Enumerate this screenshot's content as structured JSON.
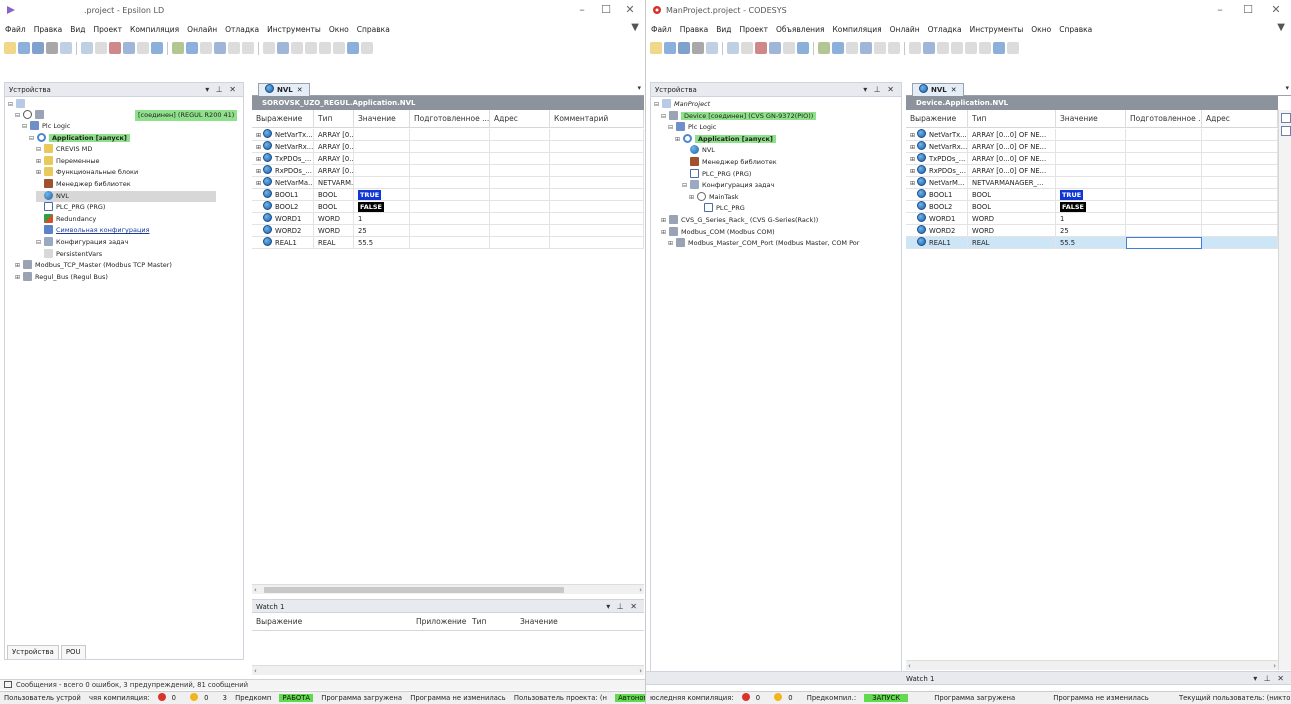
{
  "left": {
    "title": ".project - Epsilon LD",
    "menu": [
      "Файл",
      "Правка",
      "Вид",
      "Проект",
      "Компиляция",
      "Онлайн",
      "Отладка",
      "Инструменты",
      "Окно",
      "Справка"
    ],
    "devices_panel_title": "Устройства",
    "connected_label": "[соединен] (REGUL R200 41)",
    "tree": [
      {
        "label": "Plc Logic",
        "indent": 2,
        "icon": "plc-logic-icon",
        "style": ""
      },
      {
        "label": "Application [запуск]",
        "indent": 3,
        "icon": "application-icon",
        "style": "hl"
      },
      {
        "label": "CREVIS MD",
        "indent": 4,
        "icon": "folder-icon",
        "style": ""
      },
      {
        "label": "Переменные",
        "indent": 4,
        "icon": "folder-icon",
        "style": ""
      },
      {
        "label": "Функциональные блоки",
        "indent": 4,
        "icon": "folder-icon",
        "style": ""
      },
      {
        "label": "Менеджер библиотек",
        "indent": 4,
        "icon": "library-icon",
        "style": ""
      },
      {
        "label": "NVL",
        "indent": 4,
        "icon": "globe-icon",
        "style": "sel"
      },
      {
        "label": "PLC_PRG (PRG)",
        "indent": 4,
        "icon": "program-icon",
        "style": ""
      },
      {
        "label": "Redundancy",
        "indent": 4,
        "icon": "redundancy-icon",
        "style": ""
      },
      {
        "label": "Символьная конфигурация",
        "indent": 4,
        "icon": "symbol-config-icon",
        "style": "ul"
      },
      {
        "label": "Конфигурация задач",
        "indent": 4,
        "icon": "task-config-icon",
        "style": ""
      },
      {
        "label": "PersistentVars",
        "indent": 4,
        "icon": "persistent-icon",
        "style": ""
      },
      {
        "label": "Modbus_TCP_Master (Modbus TCP Master)",
        "indent": 1,
        "icon": "device-icon",
        "style": ""
      },
      {
        "label": "Regul_Bus (Regul Bus)",
        "indent": 1,
        "icon": "device-icon",
        "style": ""
      }
    ],
    "tab_label": "NVL",
    "doc_title": "SOROVSK_UZO_REGUL.Application.NVL",
    "columns": [
      "Выражение",
      "Тип",
      "Значение",
      "Подготовленное ...",
      "Адрес",
      "Комментарий"
    ],
    "rows": [
      {
        "expr": "NetVarTx...",
        "type": "ARRAY [0....",
        "value": "",
        "expand": true
      },
      {
        "expr": "NetVarRx...",
        "type": "ARRAY [0....",
        "value": "",
        "expand": true
      },
      {
        "expr": "TxPDOs_...",
        "type": "ARRAY [0....",
        "value": "",
        "expand": true
      },
      {
        "expr": "RxPDOs_...",
        "type": "ARRAY [0....",
        "value": "",
        "expand": true
      },
      {
        "expr": "NetVarMa...",
        "type": "NETVARM...",
        "value": "",
        "expand": true
      },
      {
        "expr": "BOOL1",
        "type": "BOOL",
        "value": "TRUE",
        "expand": false
      },
      {
        "expr": "BOOL2",
        "type": "BOOL",
        "value": "FALSE",
        "expand": false
      },
      {
        "expr": "WORD1",
        "type": "WORD",
        "value": "1",
        "expand": false
      },
      {
        "expr": "WORD2",
        "type": "WORD",
        "value": "25",
        "expand": false
      },
      {
        "expr": "REAL1",
        "type": "REAL",
        "value": "55.5",
        "expand": false
      }
    ],
    "watch_title": "Watch 1",
    "watch_columns": [
      "Выражение",
      "Приложение",
      "Тип",
      "Значение"
    ],
    "bottom_tabs": [
      "Устройства",
      "POU"
    ],
    "messages": "Сообщения - всего 0 ошибок, 3 предупреждений, 81 сообщений",
    "status": {
      "user_device": "Пользователь устрой",
      "last_compile": "чяя компиляция:",
      "errors": "0",
      "warnings": "0",
      "infos": "3",
      "precompile": "Предкомп",
      "run_state": "РАБОТА",
      "program_loaded": "Программа загружена",
      "program_unchanged": "Программа не изменилась",
      "project_user": "Пользователь проекта: (н",
      "offline": "Автономный"
    }
  },
  "right": {
    "title": "ManProject.project - CODESYS",
    "menu": [
      "Файл",
      "Правка",
      "Вид",
      "Проект",
      "Объявления",
      "Компиляция",
      "Онлайн",
      "Отладка",
      "Инструменты",
      "Окно",
      "Справка"
    ],
    "devices_panel_title": "Устройства",
    "tree": [
      {
        "label": "ManProject",
        "indent": 0,
        "icon": "project-icon",
        "style": "it"
      },
      {
        "label": "Device [соединен] (CVS GN-9372(PIO))",
        "indent": 1,
        "icon": "device-icon",
        "style": "hl"
      },
      {
        "label": "Plc Logic",
        "indent": 2,
        "icon": "plc-logic-icon",
        "style": ""
      },
      {
        "label": "Application [запуск]",
        "indent": 3,
        "icon": "application-icon",
        "style": "hl bold"
      },
      {
        "label": "NVL",
        "indent": 4,
        "icon": "globe-icon",
        "style": ""
      },
      {
        "label": "Менеджер библиотек",
        "indent": 4,
        "icon": "library-icon",
        "style": ""
      },
      {
        "label": "PLC_PRG (PRG)",
        "indent": 4,
        "icon": "program-icon",
        "style": ""
      },
      {
        "label": "Конфигурация задач",
        "indent": 4,
        "icon": "task-config-icon",
        "style": ""
      },
      {
        "label": "MainTask",
        "indent": 5,
        "icon": "task-icon",
        "style": ""
      },
      {
        "label": "PLC_PRG",
        "indent": 6,
        "icon": "program-icon",
        "style": ""
      },
      {
        "label": "CVS_G_Series_Rack_ (CVS G-Series(Rack))",
        "indent": 1,
        "icon": "device-icon",
        "style": ""
      },
      {
        "label": "Modbus_COM (Modbus COM)",
        "indent": 1,
        "icon": "device-icon",
        "style": ""
      },
      {
        "label": "Modbus_Master_COM_Port (Modbus Master, COM Por",
        "indent": 2,
        "icon": "device-icon",
        "style": ""
      }
    ],
    "tab_label": "NVL",
    "doc_title": "Device.Application.NVL",
    "columns": [
      "Выражение",
      "Тип",
      "Значение",
      "Подготовленное ...",
      "Адрес"
    ],
    "rows": [
      {
        "expr": "NetVarTx...",
        "type": "ARRAY [0...0] OF NE...",
        "value": "",
        "expand": true
      },
      {
        "expr": "NetVarRx...",
        "type": "ARRAY [0...0] OF NE...",
        "value": "",
        "expand": true
      },
      {
        "expr": "TxPDOs_...",
        "type": "ARRAY [0...0] OF NE...",
        "value": "",
        "expand": true
      },
      {
        "expr": "RxPDOs_...",
        "type": "ARRAY [0...0] OF NE...",
        "value": "",
        "expand": true
      },
      {
        "expr": "NetVarM...",
        "type": "NETVARMANAGER_...",
        "value": "",
        "expand": true
      },
      {
        "expr": "BOOL1",
        "type": "BOOL",
        "value": "TRUE",
        "expand": false
      },
      {
        "expr": "BOOL2",
        "type": "BOOL",
        "value": "FALSE",
        "expand": false
      },
      {
        "expr": "WORD1",
        "type": "WORD",
        "value": "1",
        "expand": false
      },
      {
        "expr": "WORD2",
        "type": "WORD",
        "value": "25",
        "expand": false
      },
      {
        "expr": "REAL1",
        "type": "REAL",
        "value": "55.5",
        "expand": false
      }
    ],
    "watch_title": "Watch 1",
    "status": {
      "last_compile": "юследняя компиляция:",
      "errors": "0",
      "warnings": "0",
      "precompile": "Предкомпил.:",
      "run_state": "ЗАПУСК",
      "program_loaded": "Программа загружена",
      "program_unchanged": "Программа не изменилась",
      "current_user": "Текущий пользователь: (никто)"
    }
  },
  "colors": {
    "highlight_green": "#8fe08a",
    "true_value": "#1037d6",
    "false_value": "#000000",
    "doc_title_bar": "#8d939d",
    "status_green": "#63d94f"
  }
}
